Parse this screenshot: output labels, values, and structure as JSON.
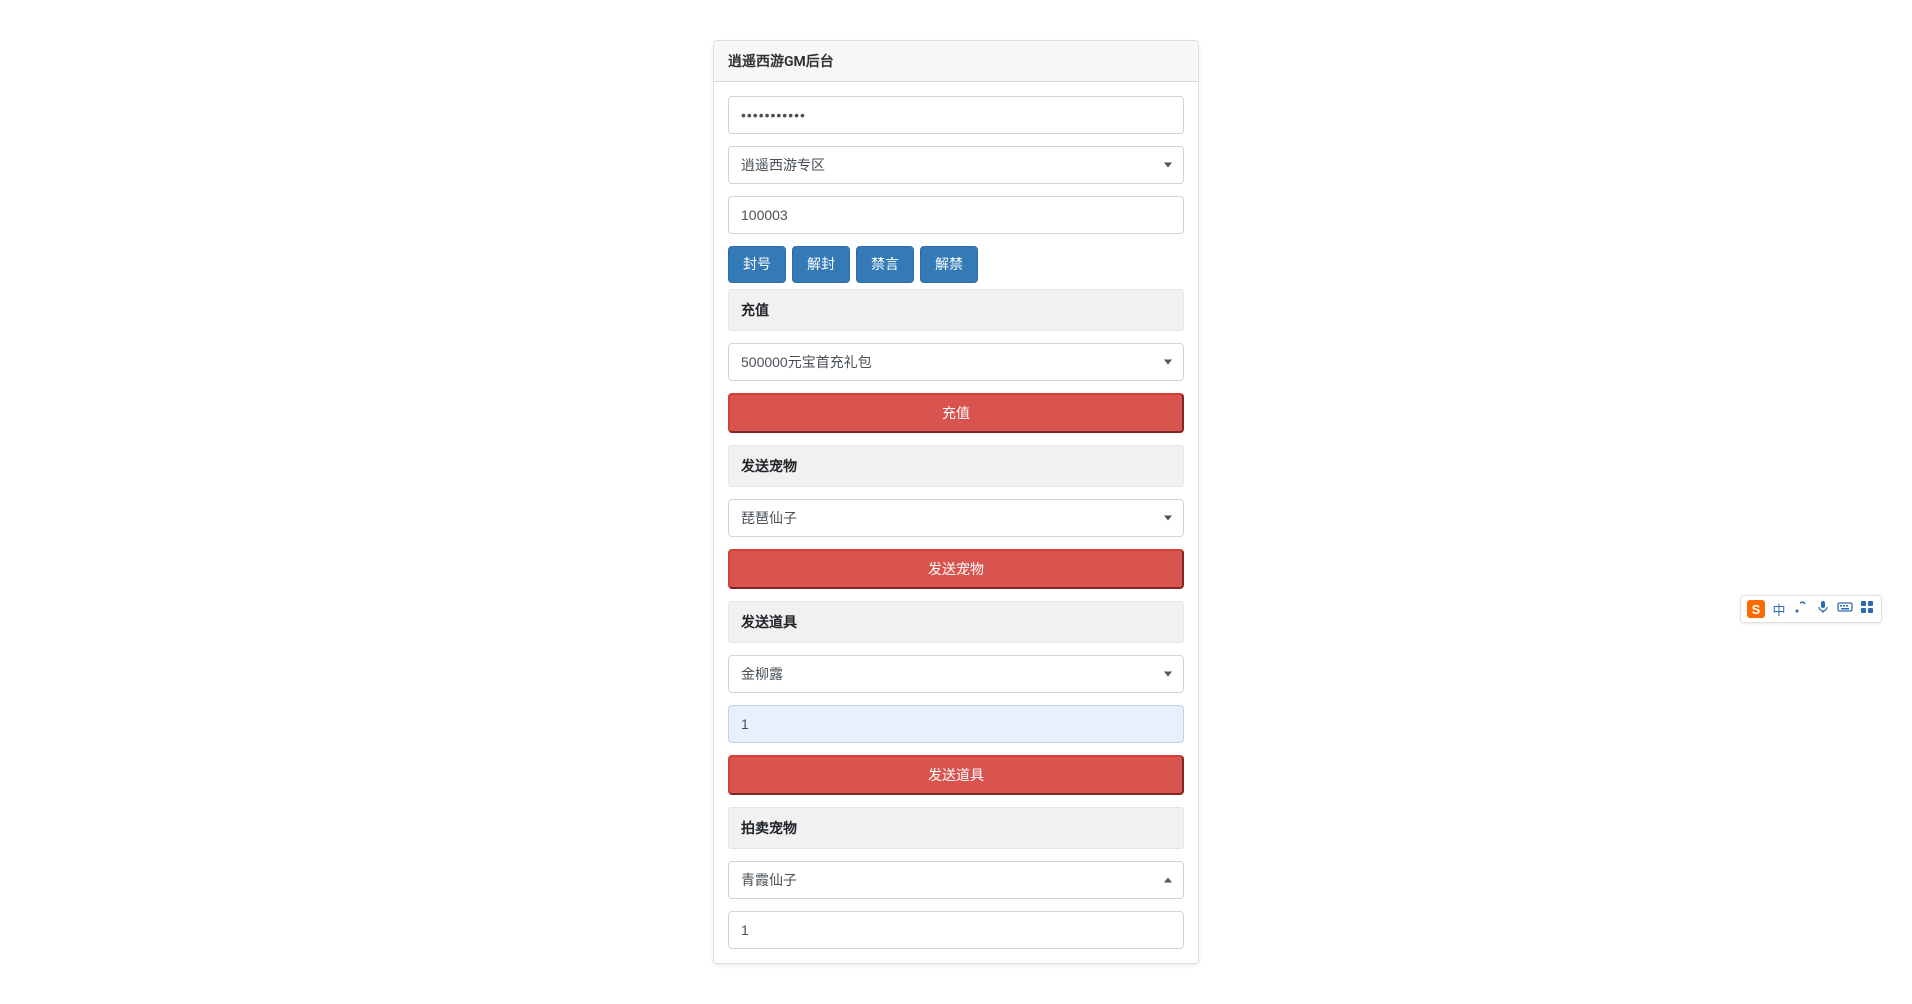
{
  "panel": {
    "title": "逍遥西游GM后台"
  },
  "auth": {
    "password_value": "•••••••••••"
  },
  "server": {
    "selected": "逍遥西游专区"
  },
  "player": {
    "id_value": "100003"
  },
  "account_actions": {
    "ban": "封号",
    "unban": "解封",
    "mute": "禁言",
    "unmute": "解禁"
  },
  "recharge": {
    "header": "充值",
    "package_selected": "500000元宝首充礼包",
    "submit": "充值"
  },
  "pet": {
    "header": "发送宠物",
    "selected": "琵琶仙子",
    "submit": "发送宠物"
  },
  "item": {
    "header": "发送道具",
    "selected": "金柳露",
    "qty_value": "1",
    "submit": "发送道具"
  },
  "auction": {
    "header": "拍卖宠物",
    "selected": "青霞仙子",
    "qty_value": "1"
  },
  "ime": {
    "logo": "S",
    "lang": "中"
  }
}
